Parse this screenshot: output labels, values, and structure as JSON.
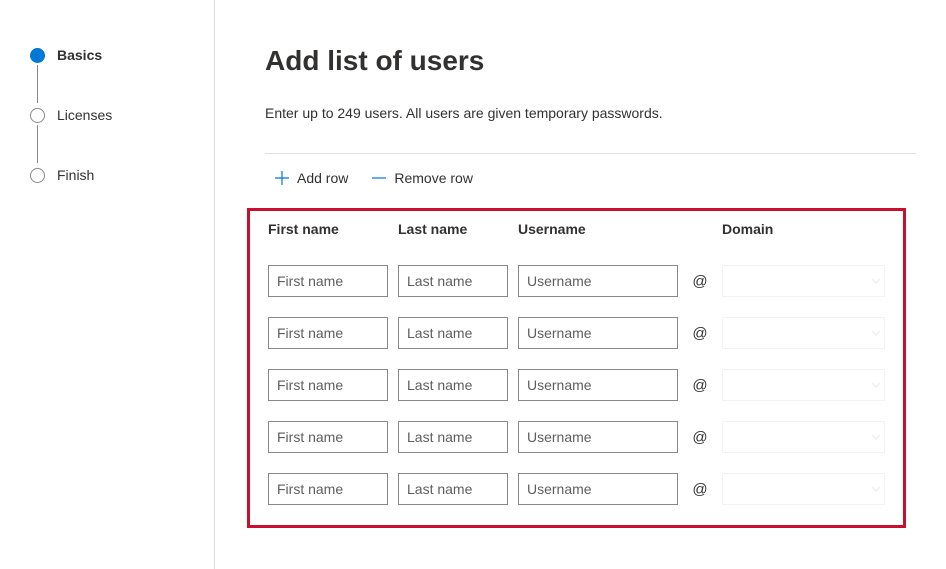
{
  "sidebar": {
    "steps": [
      {
        "label": "Basics",
        "active": true
      },
      {
        "label": "Licenses",
        "active": false
      },
      {
        "label": "Finish",
        "active": false
      }
    ]
  },
  "main": {
    "title": "Add list of users",
    "subtitle": "Enter up to 249 users. All users are given temporary passwords.",
    "toolbar": {
      "add_row": "Add row",
      "remove_row": "Remove row"
    },
    "columns": {
      "first_name": "First name",
      "last_name": "Last name",
      "username": "Username",
      "domain": "Domain"
    },
    "at_symbol": "@",
    "placeholders": {
      "first_name": "First name",
      "last_name": "Last name",
      "username": "Username"
    },
    "rows": [
      {
        "first_name": "",
        "last_name": "",
        "username": "",
        "domain": ""
      },
      {
        "first_name": "",
        "last_name": "",
        "username": "",
        "domain": ""
      },
      {
        "first_name": "",
        "last_name": "",
        "username": "",
        "domain": ""
      },
      {
        "first_name": "",
        "last_name": "",
        "username": "",
        "domain": ""
      },
      {
        "first_name": "",
        "last_name": "",
        "username": "",
        "domain": ""
      }
    ]
  }
}
